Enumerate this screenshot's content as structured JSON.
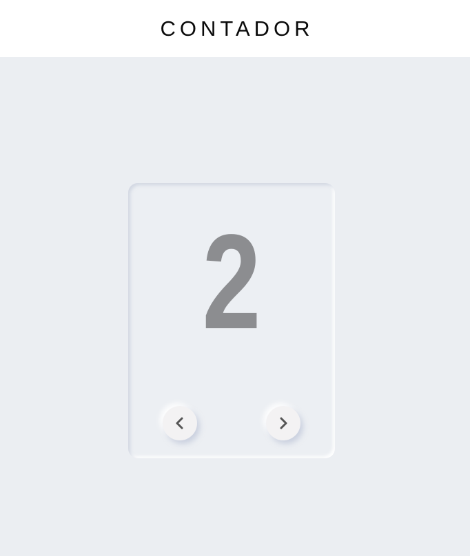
{
  "header": {
    "title": "CONTADOR"
  },
  "counter": {
    "value": "2",
    "prev_icon": "chevron-left-icon",
    "next_icon": "chevron-right-icon"
  },
  "colors": {
    "background": "#ebeef2",
    "header_background": "#ffffff",
    "number": "#8c8d90",
    "button": "#f3f2f3",
    "chevron": "#555555"
  }
}
